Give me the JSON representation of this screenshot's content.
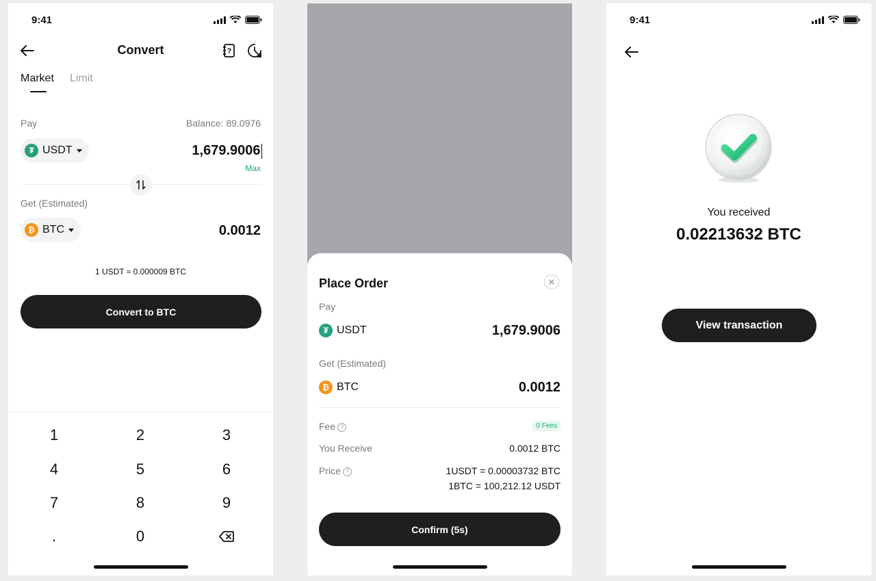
{
  "status_bar": {
    "time": "9:41"
  },
  "convert": {
    "title": "Convert",
    "tabs": [
      {
        "label": "Market"
      },
      {
        "label": "Limit"
      }
    ],
    "pay_label": "Pay",
    "balance": "Balance: 89.0976",
    "pay_coin": "USDT",
    "pay_amount": "1,679.9006",
    "max_label": "Max",
    "get_label": "Get (Estimated)",
    "get_coin": "BTC",
    "get_amount": "0.0012",
    "rate": "1 USDT ≈ 0.000009 BTC",
    "convert_button": "Convert to BTC",
    "keypad": [
      "1",
      "2",
      "3",
      "4",
      "5",
      "6",
      "7",
      "8",
      "9",
      ".",
      "0"
    ]
  },
  "place_order": {
    "title": "Place Order",
    "pay_label": "Pay",
    "pay_coin": "USDT",
    "pay_amount": "1,679.9006",
    "get_label": "Get (Estimated)",
    "get_coin": "BTC",
    "get_amount": "0.0012",
    "fee_label": "Fee",
    "fee_badge": "0 Fees",
    "receive_label": "You Receive",
    "receive_value": "0.0012 BTC",
    "price_label": "Price",
    "price_line1": "1USDT = 0.00003732 BTC",
    "price_line2": "1BTC = 100,212.12 USDT",
    "confirm_button": "Confirm (5s)"
  },
  "success": {
    "received_label": "You received",
    "received_amount": "0.02213632 BTC",
    "view_button": "View transaction"
  },
  "colors": {
    "accent_green": "#1fa971",
    "usdt": "#26a17b",
    "btc": "#f7931a",
    "button_dark": "#1f1f1f"
  }
}
